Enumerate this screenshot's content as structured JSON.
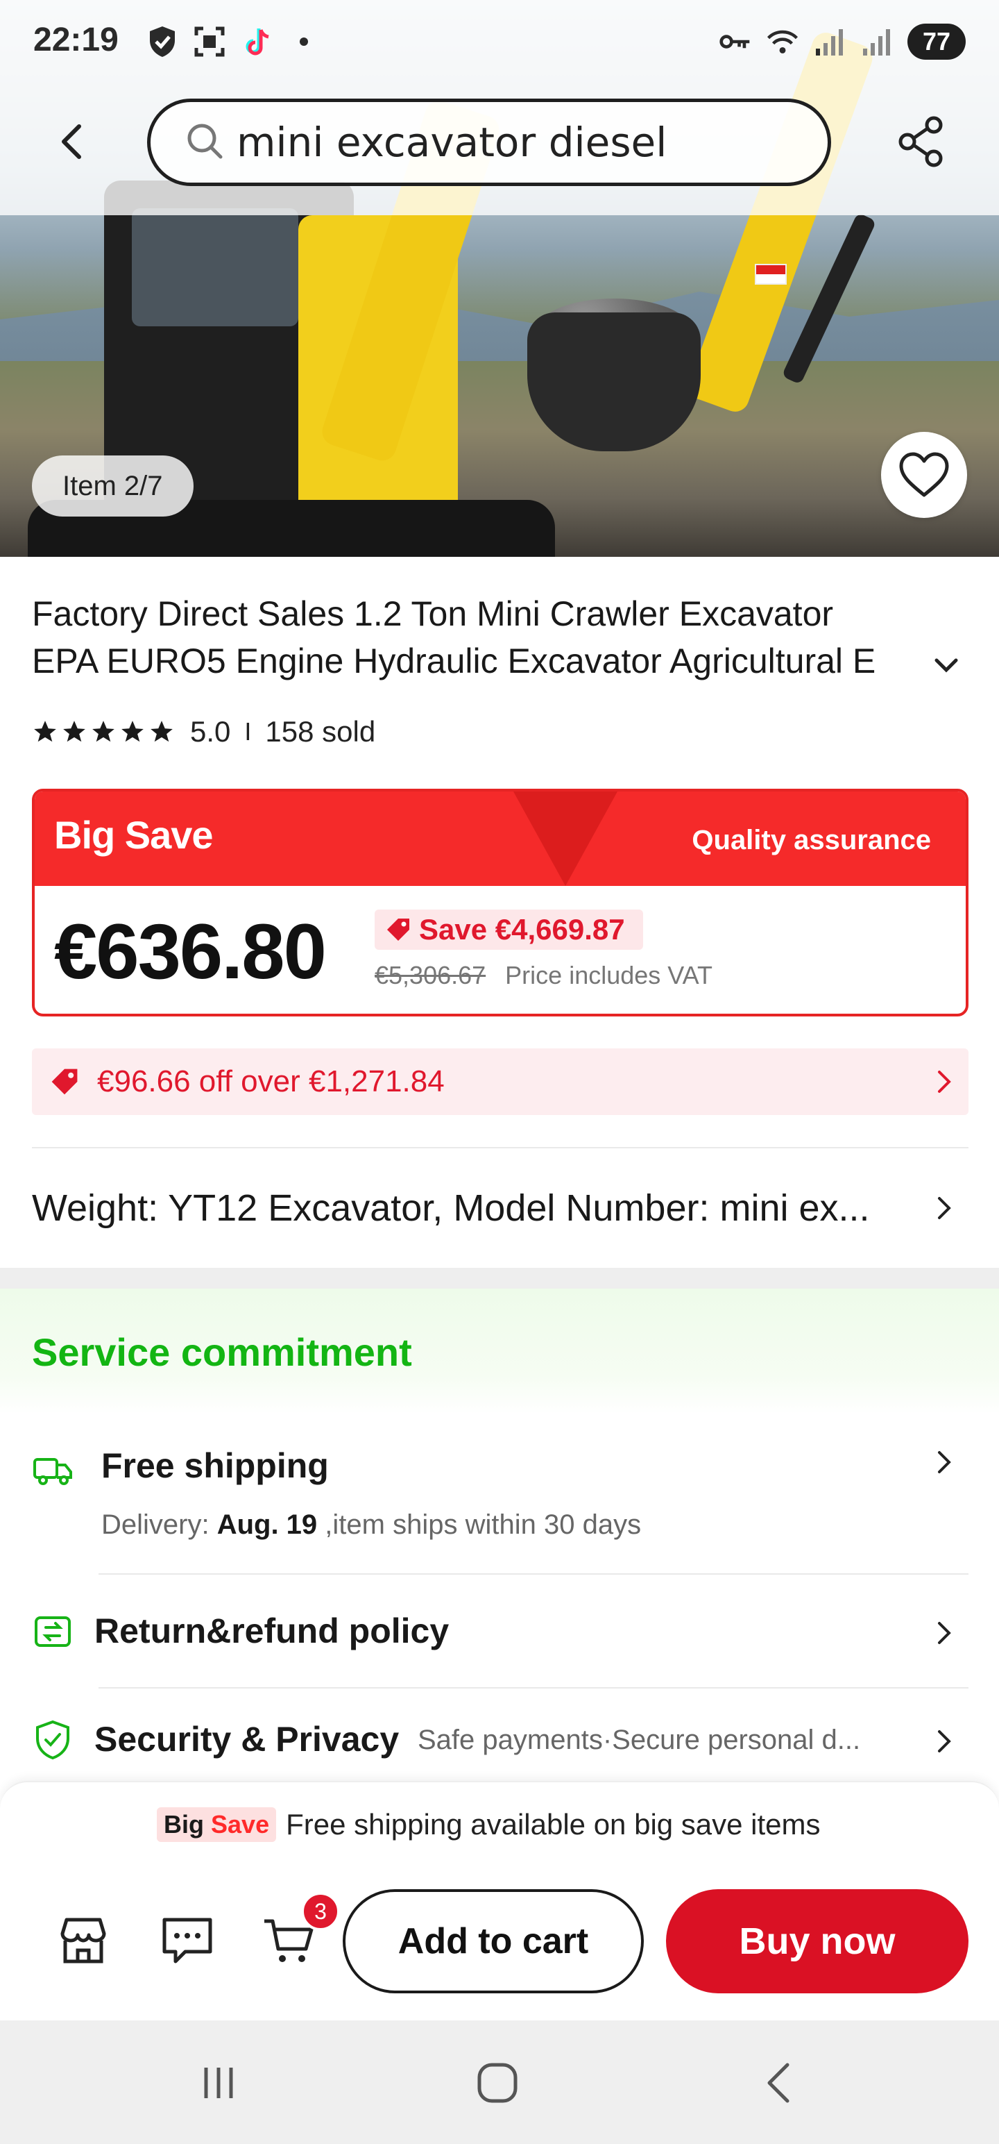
{
  "status_bar": {
    "time": "22:19",
    "battery": "77",
    "icons_left": [
      "shield-check-icon",
      "screenshot-icon",
      "tiktok-icon",
      "dot-icon"
    ],
    "icons_right": [
      "key-icon",
      "wifi-icon",
      "signal-icon",
      "signal-icon"
    ]
  },
  "header": {
    "search_value": "mini excavator diesel",
    "back_icon": "chevron-left-icon",
    "share_icon": "share-icon"
  },
  "gallery": {
    "item_indicator": "Item 2/7",
    "wishlist_icon": "heart-icon"
  },
  "product": {
    "title_line1": "Factory Direct Sales 1.2 Ton Mini Crawler Excavator",
    "title_line2": "EPA EURO5 Engine Hydraulic Excavator Agricultural E",
    "rating": "5.0",
    "rating_separator": "I",
    "sold": "158 sold",
    "stars": 5
  },
  "big_save": {
    "logo": "Big Save",
    "quality": "Quality assurance",
    "price": "€636.80",
    "save": "Save €4,669.87",
    "original_price": "€5,306.67",
    "vat_note": "Price includes VAT"
  },
  "coupon": {
    "text": "€96.66 off over €1,271.84"
  },
  "spec": {
    "text": "Weight: YT12 Excavator, Model Number: mini ex..."
  },
  "service": {
    "title": "Service commitment",
    "free_shipping": {
      "label": "Free shipping",
      "delivery_prefix": "Delivery: ",
      "delivery_date": "Aug. 19",
      "delivery_suffix": " ,item ships within 30 days"
    },
    "return": {
      "label": "Return&refund policy"
    },
    "security": {
      "label": "Security & Privacy",
      "sub": "Safe payments·Secure personal d..."
    }
  },
  "promo_strip": {
    "badge_big": "Big",
    "badge_save": "Save",
    "text": "Free shipping available on big save items"
  },
  "actions": {
    "cart_count": "3",
    "add_to_cart": "Add to cart",
    "buy_now": "Buy now"
  },
  "colors": {
    "accent_red": "#da1124",
    "big_save_red": "#f52a2a",
    "service_green": "#13b513"
  }
}
